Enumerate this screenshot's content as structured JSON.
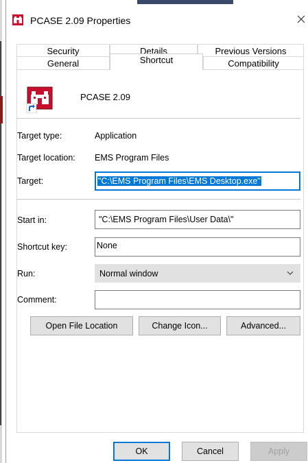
{
  "window": {
    "title": "PCASE 2.09 Properties"
  },
  "tabs": {
    "row1": [
      "Security",
      "Details",
      "Previous Versions"
    ],
    "row2": [
      "General",
      "Shortcut",
      "Compatibility"
    ],
    "active": "Shortcut"
  },
  "shortcut": {
    "name": "PCASE 2.09",
    "target_type_label": "Target type:",
    "target_type_value": "Application",
    "target_location_label": "Target location:",
    "target_location_value": "EMS Program Files",
    "target_label": "Target:",
    "target_value": "\"C:\\EMS Program Files\\EMS Desktop.exe\"",
    "start_in_label": "Start in:",
    "start_in_value": "\"C:\\EMS Program Files\\User Data\\\"",
    "shortcut_key_label": "Shortcut key:",
    "shortcut_key_value": "None",
    "run_label": "Run:",
    "run_value": "Normal window",
    "comment_label": "Comment:",
    "comment_value": ""
  },
  "buttons": {
    "open_file_location": "Open File Location",
    "change_icon": "Change Icon...",
    "advanced": "Advanced...",
    "ok": "OK",
    "cancel": "Cancel",
    "apply": "Apply"
  },
  "colors": {
    "accent": "#0078d7",
    "icon_red": "#c8102e"
  }
}
